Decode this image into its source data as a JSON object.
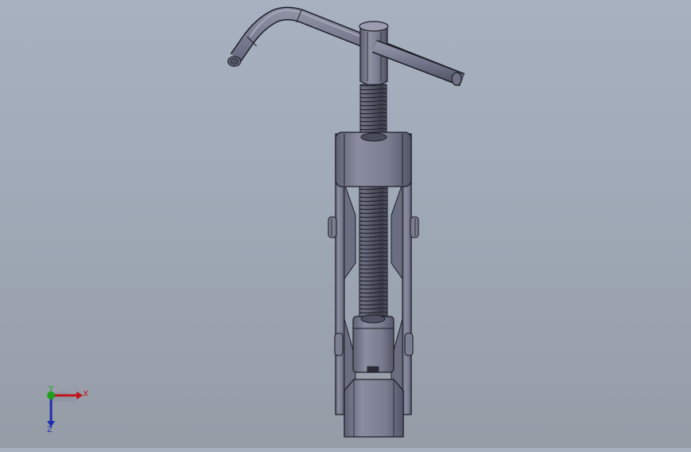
{
  "viewport": {
    "background_top": "#a7b1c0",
    "background_bottom": "#959ca6"
  },
  "model": {
    "part_color": "#7a7d8f",
    "edge_color": "#1e1f28",
    "thread_color": "#55576a"
  },
  "triad": {
    "x_label": "X",
    "y_label": "Y",
    "z_label": "Z",
    "x_color": "#c0151b",
    "y_color": "#1ea01e",
    "z_color": "#1f2fb0"
  }
}
